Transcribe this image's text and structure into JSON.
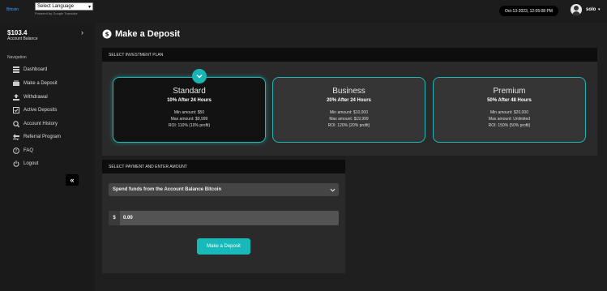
{
  "header": {
    "logo": "Bitcoin",
    "language_select": "Select Language",
    "powered_by": "Powered by Google Translate",
    "datetime": "Oct-13-2023, 12:05:08 PM",
    "user_name": "solo"
  },
  "sidebar": {
    "balance_amount": "$103.4",
    "balance_label": "Account Balance",
    "nav_heading": "Navigation",
    "items": [
      {
        "label": "Dashboard",
        "icon": "dashboard-icon"
      },
      {
        "label": "Make a Deposit",
        "icon": "deposit-icon"
      },
      {
        "label": "Withdrawal",
        "icon": "withdrawal-icon"
      },
      {
        "label": "Active Deposits",
        "icon": "active-deposits-icon"
      },
      {
        "label": "Account History",
        "icon": "history-icon"
      },
      {
        "label": "Referral Program",
        "icon": "referral-icon"
      },
      {
        "label": "FAQ",
        "icon": "faq-icon"
      },
      {
        "label": "Logout",
        "icon": "logout-icon"
      }
    ],
    "collapse_glyph": "«"
  },
  "page": {
    "title": "Make a Deposit"
  },
  "plans_section": {
    "header": "SELECT INVESTMENT PLAN",
    "plans": [
      {
        "name": "Standard",
        "rate": "10% After 24 Hours",
        "min": "Min amount: $50",
        "max": "Max amount: $9,999",
        "roi": "ROI: 110% (10% profit)",
        "selected": true
      },
      {
        "name": "Business",
        "rate": "20% After 24 Hours",
        "min": "Min amount: $10,000",
        "max": "Max amount: $19,999",
        "roi": "ROI: 120% (20% profit)",
        "selected": false
      },
      {
        "name": "Premium",
        "rate": "50% After 48 Hours",
        "min": "Min amount: $20,000",
        "max": "Max amount: Unlimited",
        "roi": "ROI: 150% (50% profit)",
        "selected": false
      }
    ]
  },
  "payment_section": {
    "header": "SELECT PAYMENT AND ENTER AMOUNT",
    "payment_method": "Spend funds from the Account Balance Bitcoin",
    "currency_symbol": "$",
    "amount_value": "0.00",
    "submit_label": "Make a Deposit"
  },
  "colors": {
    "accent": "#19b4b4",
    "background": "#1f1f1f",
    "panel": "#2a2a2a"
  }
}
